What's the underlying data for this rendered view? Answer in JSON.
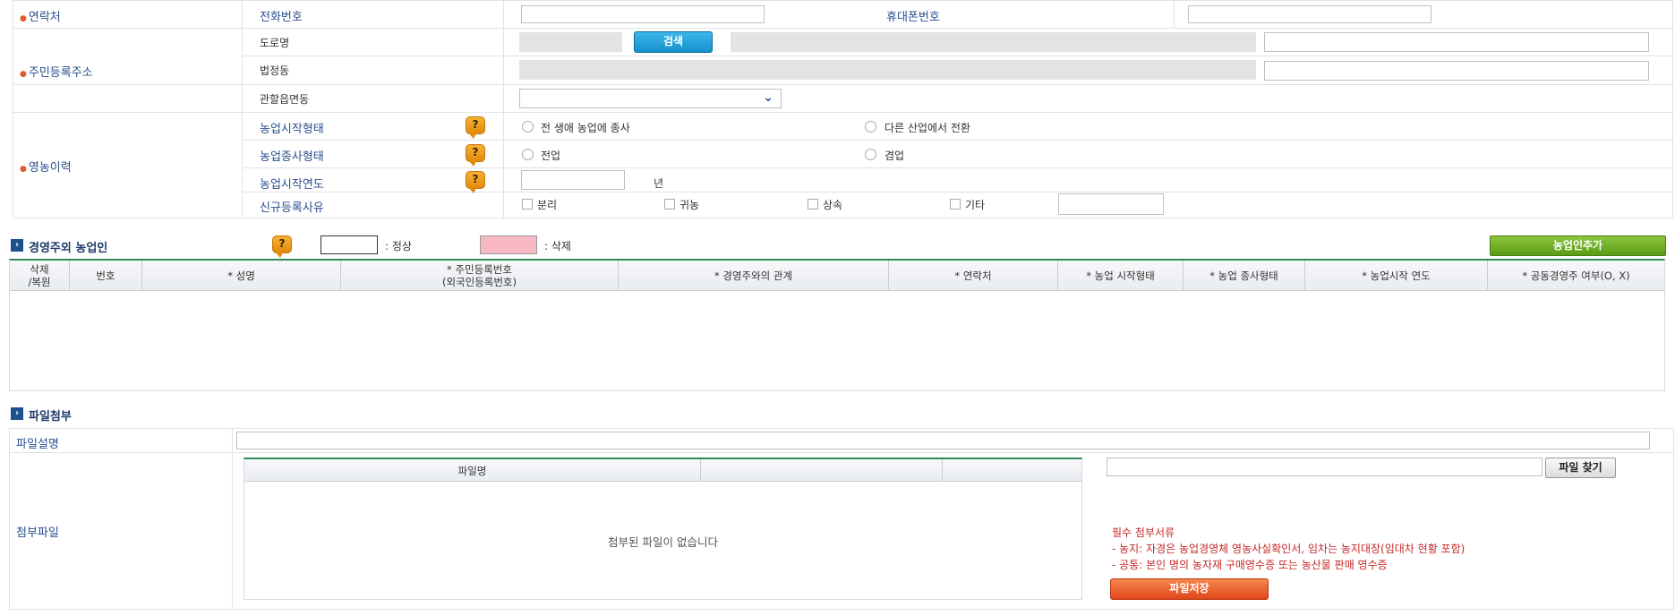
{
  "contact": {
    "label": "연락처",
    "phone_label": "전화번호",
    "phone_value": "",
    "mobile_label": "휴대폰번호",
    "mobile_value": ""
  },
  "address": {
    "label": "주민등록주소",
    "road_label": "도로명",
    "search_button": "검색",
    "legal_dong_label": "법정동",
    "jurisdiction_label": "관할읍면동",
    "jurisdiction_value": ""
  },
  "farming_history": {
    "label": "영농이력",
    "start_type_label": "농업시작형태",
    "start_type_options": [
      "전 생애 농업에 종사",
      "다른 산업에서 전환"
    ],
    "engage_type_label": "농업종사형태",
    "engage_type_options": [
      "전업",
      "겸업"
    ],
    "start_year_label": "농업시작연도",
    "start_year_value": "",
    "year_unit": "년",
    "new_reason_label": "신규등록사유",
    "new_reason_options": [
      "분리",
      "귀농",
      "상속",
      "기타"
    ],
    "other_value": ""
  },
  "farmers_section": {
    "title": "경영주외 농업인",
    "legend_normal": ": 정상",
    "legend_deleted": ": 삭제",
    "add_button": "농업인추가",
    "columns": [
      "삭제\n/복원",
      "번호",
      "* 성명",
      "* 주민등록번호\n(외국인등록번호)",
      "* 경영주와의 관계",
      "* 연락처",
      "* 농업 시작형태",
      "* 농업 종사형태",
      "* 농업시작 연도",
      "* 공동경영주 여부(O, X)"
    ],
    "rows": []
  },
  "attachment_section": {
    "title": "파일첨부",
    "file_desc_label": "파일설명",
    "file_desc_value": "",
    "attach_label": "첨부파일",
    "file_name_header": "파일명",
    "empty_message": "첨부된 파일이 없습니다",
    "file_path_value": "",
    "find_button": "파일 찾기",
    "required_title": "필수 첨부서류",
    "required_line1": "- 농지: 자경은 농업경영체 영농사실확인서, 임차는 농지대장(임대차 현황 포함)",
    "required_line2": "- 공통: 본인 명의 농자재 구매영수증 또는 농산물 판매 영수증",
    "save_button": "파일저장"
  },
  "colors": {
    "label_blue": "#2a4f8f",
    "required_mark": "#e25b2a",
    "table_header_line": "#2e8b57",
    "deleted_swatch": "#f9b9c4",
    "notice_red": "#c62828"
  }
}
